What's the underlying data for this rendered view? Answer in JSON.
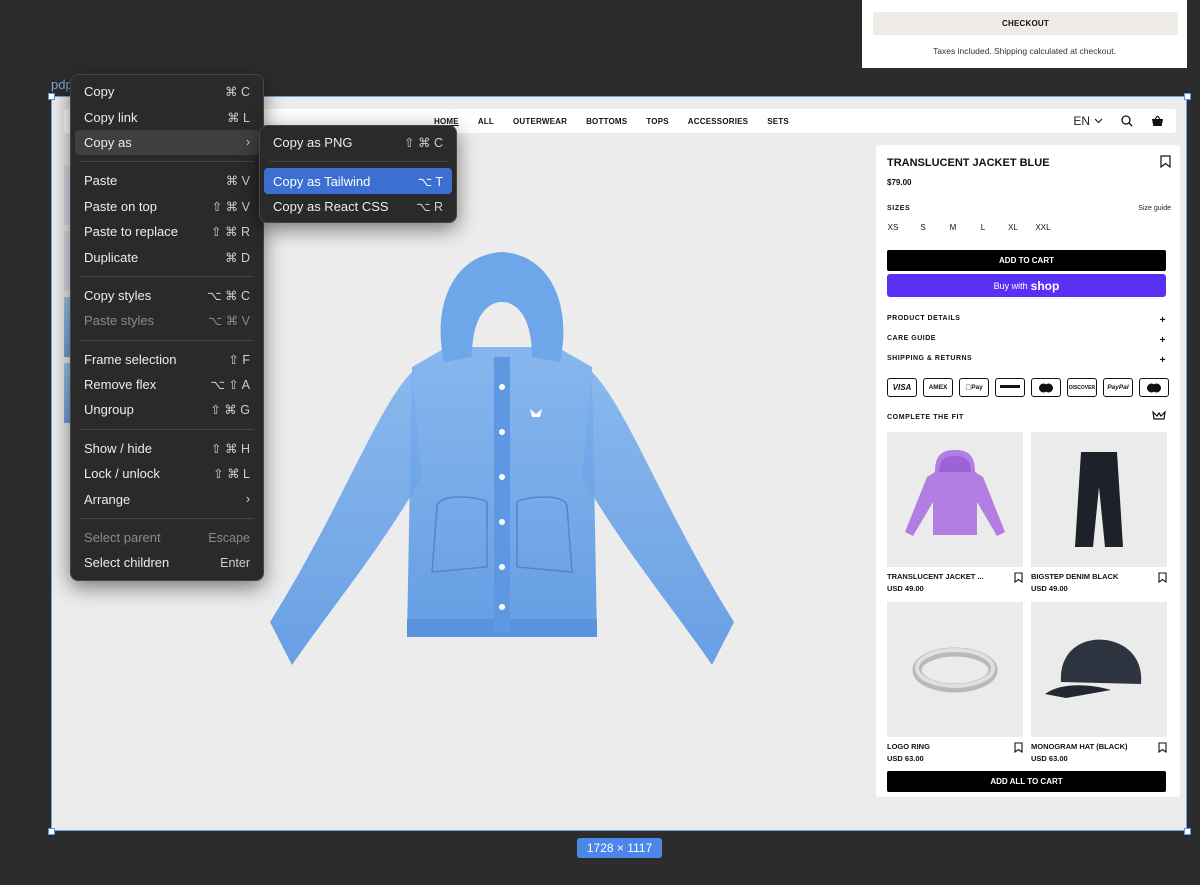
{
  "cart_fragment": {
    "checkout_label": "CHECKOUT",
    "taxes_note": "Taxes included. Shipping calculated at checkout."
  },
  "frame": {
    "label": "pdp",
    "dimensions_badge": "1728 × 1117",
    "selection_color": "#4b86e8"
  },
  "nav": {
    "links": [
      "HOME",
      "ALL",
      "OUTERWEAR",
      "BOTTOMS",
      "TOPS",
      "ACCESSORIES",
      "SETS"
    ],
    "language": "EN",
    "icons": [
      "chevron-down-icon",
      "search-icon",
      "basket-icon"
    ]
  },
  "product": {
    "title": "TRANSLUCENT JACKET BLUE",
    "price": "$79.00",
    "sizes_label": "SIZES",
    "size_guide": "Size guide",
    "sizes": [
      "XS",
      "S",
      "M",
      "L",
      "XL",
      "XXL"
    ],
    "add_to_cart": "ADD TO CART",
    "buy_with": "Buy with",
    "shop_brand": "shop",
    "shop_color": "#5a31f4",
    "accordions": [
      "PRODUCT DETAILS",
      "CARE GUIDE",
      "SHIPPING & RETURNS"
    ],
    "accordion_plus": "+",
    "payment_methods": [
      "VISA",
      "AMEX",
      "Pay",
      "",
      "",
      "DISCOVER",
      "PayPal",
      ""
    ],
    "complete_fit": "COMPLETE THE FIT",
    "recommendations": [
      {
        "name": "TRANSLUCENT JACKET ...",
        "price": "USD 49.00"
      },
      {
        "name": "BIGSTEP DENIM BLACK",
        "price": "USD 49.00"
      },
      {
        "name": "LOGO RING",
        "price": "USD 63.00"
      },
      {
        "name": "MONOGRAM HAT (BLACK)",
        "price": "USD 63.00"
      }
    ],
    "add_all": "ADD ALL TO CART"
  },
  "context_menu": {
    "items": [
      {
        "label": "Copy",
        "shortcut": "⌘ C"
      },
      {
        "label": "Copy link",
        "shortcut": "⌘ L"
      },
      {
        "label": "Copy as",
        "shortcut": "›"
      },
      {
        "label": "Paste",
        "shortcut": "⌘ V"
      },
      {
        "label": "Paste on top",
        "shortcut": "⇧ ⌘ V"
      },
      {
        "label": "Paste to replace",
        "shortcut": "⇧ ⌘ R"
      },
      {
        "label": "Duplicate",
        "shortcut": "⌘ D"
      },
      {
        "label": "Copy styles",
        "shortcut": "⌥ ⌘ C"
      },
      {
        "label": "Paste styles",
        "shortcut": "⌥ ⌘ V"
      },
      {
        "label": "Frame selection",
        "shortcut": "⇧ F"
      },
      {
        "label": "Remove flex",
        "shortcut": "⌥ ⇧ A"
      },
      {
        "label": "Ungroup",
        "shortcut": "⇧ ⌘ G"
      },
      {
        "label": "Show / hide",
        "shortcut": "⇧ ⌘ H"
      },
      {
        "label": "Lock / unlock",
        "shortcut": "⇧ ⌘ L"
      },
      {
        "label": "Arrange",
        "shortcut": "›"
      },
      {
        "label": "Select parent",
        "shortcut": "Escape"
      },
      {
        "label": "Select children",
        "shortcut": "Enter"
      }
    ],
    "submenu": [
      {
        "label": "Copy as PNG",
        "shortcut": "⇧ ⌘ C"
      },
      {
        "label": "Copy as Tailwind",
        "shortcut": "⌥ T"
      },
      {
        "label": "Copy as React CSS",
        "shortcut": "⌥ R"
      }
    ],
    "highlight_color": "#3b6fd1"
  }
}
